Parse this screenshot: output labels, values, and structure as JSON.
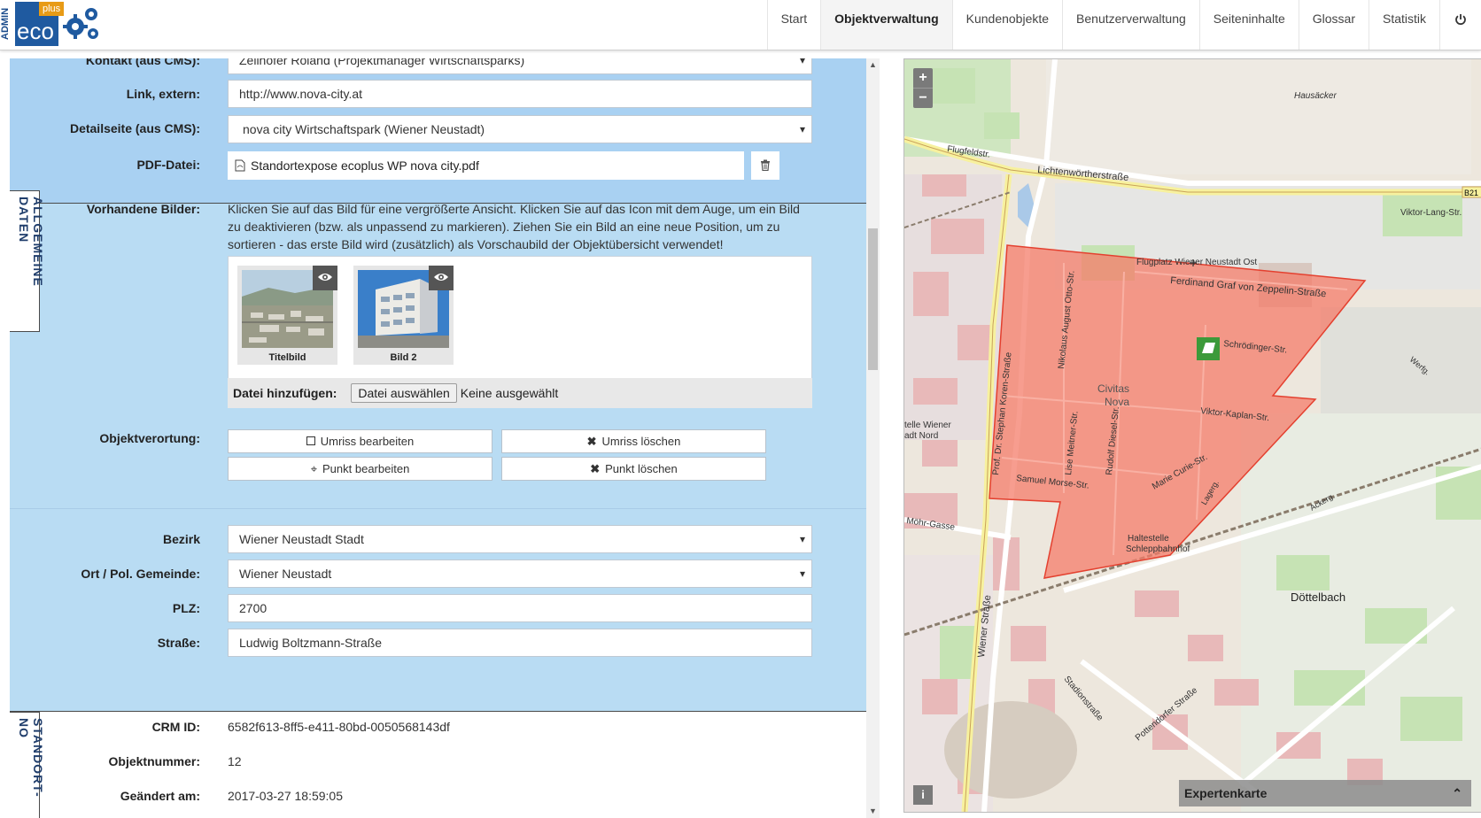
{
  "logo": {
    "admin": "ADMIN",
    "eco": "eco",
    "plus": "plus"
  },
  "nav": {
    "items": [
      "Start",
      "Objektverwaltung",
      "Kundenobjekte",
      "Benutzerverwaltung",
      "Seiteninhalte",
      "Glossar",
      "Statistik"
    ],
    "active": "Objektverwaltung",
    "power_icon": "power-icon"
  },
  "form": {
    "contact_label": "Kontakt (aus CMS):",
    "contact_value": "Zellhofer Roland (Projektmanager Wirtschaftsparks)",
    "link_label": "Link, extern:",
    "link_value": "http://www.nova-city.at",
    "detail_label": "Detailseite (aus CMS):",
    "detail_value": "nova city Wirtschaftspark (Wiener Neustadt)",
    "pdf_label": "PDF-Datei:",
    "pdf_value": "Standortexpose ecoplus WP nova city.pdf",
    "images_label": "Vorhandene Bilder:",
    "images_desc": "Klicken Sie auf das Bild für eine vergrößerte Ansicht. Klicken Sie auf das Icon mit dem Auge, um ein Bild zu deaktivieren (bzw. als unpassend zu markieren). Ziehen Sie ein Bild an eine neue Position, um zu sortieren - das erste Bild wird (zusätzlich) als Vorschaubild der Objektübersicht verwendet!",
    "images": [
      {
        "caption": "Titelbild"
      },
      {
        "caption": "Bild 2"
      }
    ],
    "add_file_label": "Datei hinzufügen:",
    "choose_file_button": "Datei auswählen",
    "no_file_text": "Keine ausgewählt",
    "verortung_label": "Objektverortung:",
    "btn_outline_edit": "Umriss bearbeiten",
    "btn_outline_delete": "Umriss löschen",
    "btn_point_edit": "Punkt bearbeiten",
    "btn_point_delete": "Punkt löschen",
    "bezirk_label": "Bezirk",
    "bezirk_value": "Wiener Neustadt Stadt",
    "ort_label": "Ort / Pol. Gemeinde:",
    "ort_value": "Wiener Neustadt",
    "plz_label": "PLZ:",
    "plz_value": "2700",
    "strasse_label": "Straße:",
    "strasse_value": "Ludwig Boltzmann-Straße",
    "crm_label": "CRM ID:",
    "crm_value": "6582f613-8ff5-e411-80bd-0050568143df",
    "objnr_label": "Objektnummer:",
    "objnr_value": "12",
    "changed_label": "Geändert am:",
    "changed_value": "2017-03-27 18:59:05"
  },
  "tabs": {
    "allgemeine": "ALLGEMEINE DATEN",
    "standort": "STANDORT-NO"
  },
  "map": {
    "zoom_in": "+",
    "zoom_out": "−",
    "info": "i",
    "expert_label": "Expertenkarte",
    "polygon_color": "#f47c6a",
    "labels": {
      "hausaecker": "Hausäcker",
      "flugfeldstr": "Flugfeldstr.",
      "lichtenwoerther": "Lichtenwörtherstraße",
      "viktor_lang": "Viktor-Lang-Str.",
      "flugplatz": "Flugplatz Wiener Neustadt Ost",
      "zeppelin": "Ferdinand Graf von Zeppelin-Straße",
      "schroedinger": "Schrödinger-Str.",
      "civitas": "Civitas",
      "nova": "Nova",
      "viktor_kaplan": "Viktor-Kaplan-Str.",
      "samuel_morse": "Samuel Morse-Str.",
      "marie_curie": "Marie Curie-Str.",
      "wiener_strasse": "Wiener Straße",
      "doettelbach": "Döttelbach",
      "haltestelle": "Haltestelle",
      "schleppbahnhof": "Schleppbahnhof",
      "wiener_nord_1": "telle Wiener",
      "wiener_nord_2": "adt Nord",
      "moehr_gasse": "Möhr-Gasse",
      "stadionstrasse": "Stadionstraße",
      "pottendorfer": "Pottendorfer Straße",
      "lagerg": "Lagerg.",
      "ackerg": "Ackerg.",
      "werfg": "Werfg.",
      "rudolf_diesel": "Rudolf Diesel-Str.",
      "nikolaus": "Nikolaus August Otto-Str.",
      "lise_meitner": "Lise Meitner-Str.",
      "stephan_koren": "Prof. Dr. Stephan Koren-Straße",
      "b21": "B21"
    }
  }
}
